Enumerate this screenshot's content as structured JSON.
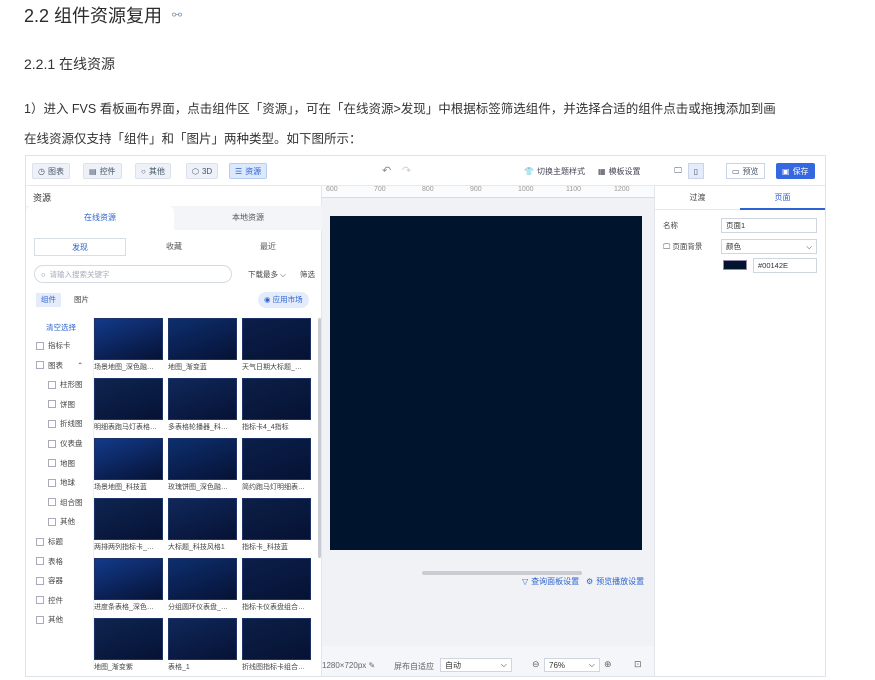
{
  "doc": {
    "h2": "2.2 组件资源复用",
    "h3": "2.2.1 在线资源",
    "p1": "1）进入 FVS 看板画布界面，点击组件区「资源」，可在「在线资源>发现」中根据标签筛选组件，并选择合适的组件点击或拖拽添加到画",
    "p2": "在线资源仅支持「组件」和「图片」两种类型。如下图所示："
  },
  "toolbar": {
    "left_buttons": [
      {
        "label": "图表",
        "icon": "clock-icon"
      },
      {
        "label": "控件",
        "icon": "control-icon"
      },
      {
        "label": "其他",
        "icon": "circle-icon"
      },
      {
        "label": "3D",
        "icon": "cube-icon"
      },
      {
        "label": "资源",
        "icon": "resource-icon",
        "active": true
      }
    ],
    "undo": "↶",
    "redo": "↷",
    "theme_label": "切换主题样式",
    "template_label": "模板设置",
    "preview_label": "预览",
    "save_label": "保存"
  },
  "resource_panel": {
    "title": "资源",
    "source_tabs": [
      "在线资源",
      "本地资源"
    ],
    "sub_tabs": [
      "发现",
      "收藏",
      "最近"
    ],
    "search_placeholder": "请输入搜索关键字",
    "sort_label": "下载最多",
    "filter_label": "筛选",
    "type_tabs": [
      "组件",
      "图片"
    ],
    "market_label": "应用市场",
    "clear_label": "清空选择",
    "filters": [
      {
        "label": "指标卡",
        "indent": false
      },
      {
        "label": "图表",
        "indent": false,
        "expanded": true
      },
      {
        "label": "柱形图",
        "indent": true
      },
      {
        "label": "饼图",
        "indent": true
      },
      {
        "label": "折线图",
        "indent": true
      },
      {
        "label": "仪表盘",
        "indent": true
      },
      {
        "label": "地图",
        "indent": true
      },
      {
        "label": "地球",
        "indent": true
      },
      {
        "label": "组合图",
        "indent": true
      },
      {
        "label": "其他",
        "indent": true
      },
      {
        "label": "标题",
        "indent": false
      },
      {
        "label": "表格",
        "indent": false
      },
      {
        "label": "容器",
        "indent": false
      },
      {
        "label": "控件",
        "indent": false
      },
      {
        "label": "其他",
        "indent": false
      }
    ],
    "cards": [
      "场景地图_深色融…",
      "地图_渐变蓝",
      "天气日期大标题_…",
      "明细表跑马灯表格…",
      "多表格轮播器_科…",
      "指标卡4_4指标",
      "场景地图_科技蓝",
      "玫瑰饼图_深色融…",
      "简约跑马灯明细表…",
      "两排两列指标卡_…",
      "大标题_科技风格1",
      "指标卡_科技蓝",
      "进度条表格_深色…",
      "分组圆环仪表盘_…",
      "指标卡仪表盘组合…",
      "地图_渐变紫",
      "表格_1",
      "折线图指标卡组合…"
    ]
  },
  "canvas": {
    "ruler_ticks": [
      "600",
      "700",
      "800",
      "900",
      "1000",
      "1100",
      "1200"
    ],
    "background": "#00142E",
    "query_settings": "查询面板设置",
    "preset_settings": "预览播放设置",
    "size_label": "1280×720px",
    "adapt_label": "屏布自适应",
    "adapt_value": "自动",
    "zoom_value": "76%"
  },
  "props_panel": {
    "tabs": [
      "过渡",
      "页面"
    ],
    "name_label": "名称",
    "name_value": "页面1",
    "bg_label": "页面背景",
    "bg_type": "颜色",
    "bg_color": "#00142E"
  }
}
